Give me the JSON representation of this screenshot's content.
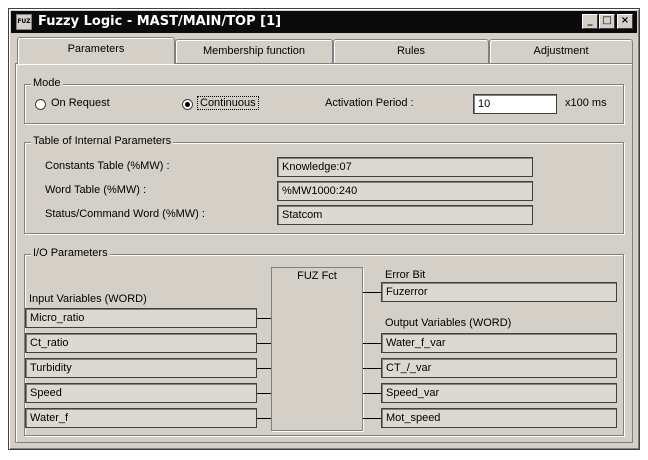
{
  "window": {
    "title": "Fuzzy Logic - MAST/MAIN/TOP [1]",
    "icon_text": "FUZ",
    "controls": {
      "minimize": "_",
      "maximize": "□",
      "close": "×"
    }
  },
  "tabs": [
    {
      "label": "Parameters",
      "active": true
    },
    {
      "label": "Membership function"
    },
    {
      "label": "Rules"
    },
    {
      "label": "Adjustment"
    }
  ],
  "mode": {
    "legend": "Mode",
    "option_on_request": "On Request",
    "option_continuous": "Continuous",
    "selected": "Continuous",
    "activation_label": "Activation Period :",
    "activation_value": "10",
    "activation_unit": "x100 ms"
  },
  "internal": {
    "legend": "Table of Internal Parameters",
    "rows": [
      {
        "label": "Constants Table (%MW) :",
        "value": "Knowledge:07"
      },
      {
        "label": "Word Table (%MW) :",
        "value": "%MW1000:240"
      },
      {
        "label": "Status/Command Word (%MW) :",
        "value": "Statcom"
      }
    ]
  },
  "io": {
    "legend": "I/O Parameters",
    "fuz_label": "FUZ Fct",
    "inputs_label": "Input Variables (WORD)",
    "inputs": [
      "Micro_ratio",
      "Ct_ratio",
      "Turbidity",
      "Speed",
      "Water_f"
    ],
    "error_label": "Error Bit",
    "error_value": "Fuzerror",
    "outputs_label": "Output Variables (WORD)",
    "outputs": [
      "Water_f_var",
      "CT_/_var",
      "Speed_var",
      "Mot_speed"
    ]
  }
}
